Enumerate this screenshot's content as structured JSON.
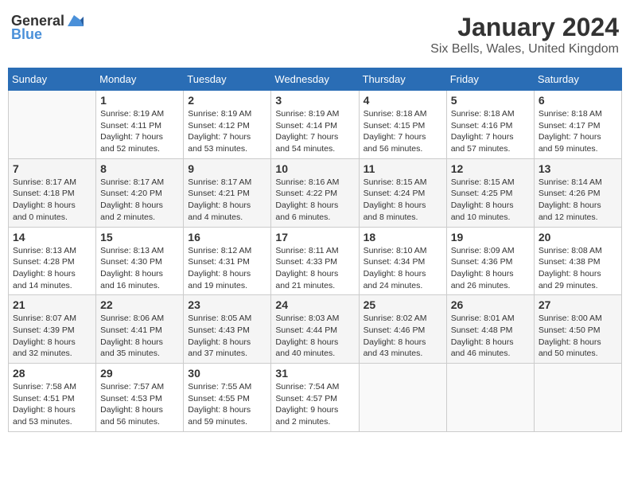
{
  "header": {
    "logo_general": "General",
    "logo_blue": "Blue",
    "month_title": "January 2024",
    "location": "Six Bells, Wales, United Kingdom"
  },
  "weekdays": [
    "Sunday",
    "Monday",
    "Tuesday",
    "Wednesday",
    "Thursday",
    "Friday",
    "Saturday"
  ],
  "weeks": [
    [
      {
        "day": "",
        "info": ""
      },
      {
        "day": "1",
        "info": "Sunrise: 8:19 AM\nSunset: 4:11 PM\nDaylight: 7 hours\nand 52 minutes."
      },
      {
        "day": "2",
        "info": "Sunrise: 8:19 AM\nSunset: 4:12 PM\nDaylight: 7 hours\nand 53 minutes."
      },
      {
        "day": "3",
        "info": "Sunrise: 8:19 AM\nSunset: 4:14 PM\nDaylight: 7 hours\nand 54 minutes."
      },
      {
        "day": "4",
        "info": "Sunrise: 8:18 AM\nSunset: 4:15 PM\nDaylight: 7 hours\nand 56 minutes."
      },
      {
        "day": "5",
        "info": "Sunrise: 8:18 AM\nSunset: 4:16 PM\nDaylight: 7 hours\nand 57 minutes."
      },
      {
        "day": "6",
        "info": "Sunrise: 8:18 AM\nSunset: 4:17 PM\nDaylight: 7 hours\nand 59 minutes."
      }
    ],
    [
      {
        "day": "7",
        "info": "Sunrise: 8:17 AM\nSunset: 4:18 PM\nDaylight: 8 hours\nand 0 minutes."
      },
      {
        "day": "8",
        "info": "Sunrise: 8:17 AM\nSunset: 4:20 PM\nDaylight: 8 hours\nand 2 minutes."
      },
      {
        "day": "9",
        "info": "Sunrise: 8:17 AM\nSunset: 4:21 PM\nDaylight: 8 hours\nand 4 minutes."
      },
      {
        "day": "10",
        "info": "Sunrise: 8:16 AM\nSunset: 4:22 PM\nDaylight: 8 hours\nand 6 minutes."
      },
      {
        "day": "11",
        "info": "Sunrise: 8:15 AM\nSunset: 4:24 PM\nDaylight: 8 hours\nand 8 minutes."
      },
      {
        "day": "12",
        "info": "Sunrise: 8:15 AM\nSunset: 4:25 PM\nDaylight: 8 hours\nand 10 minutes."
      },
      {
        "day": "13",
        "info": "Sunrise: 8:14 AM\nSunset: 4:26 PM\nDaylight: 8 hours\nand 12 minutes."
      }
    ],
    [
      {
        "day": "14",
        "info": "Sunrise: 8:13 AM\nSunset: 4:28 PM\nDaylight: 8 hours\nand 14 minutes."
      },
      {
        "day": "15",
        "info": "Sunrise: 8:13 AM\nSunset: 4:30 PM\nDaylight: 8 hours\nand 16 minutes."
      },
      {
        "day": "16",
        "info": "Sunrise: 8:12 AM\nSunset: 4:31 PM\nDaylight: 8 hours\nand 19 minutes."
      },
      {
        "day": "17",
        "info": "Sunrise: 8:11 AM\nSunset: 4:33 PM\nDaylight: 8 hours\nand 21 minutes."
      },
      {
        "day": "18",
        "info": "Sunrise: 8:10 AM\nSunset: 4:34 PM\nDaylight: 8 hours\nand 24 minutes."
      },
      {
        "day": "19",
        "info": "Sunrise: 8:09 AM\nSunset: 4:36 PM\nDaylight: 8 hours\nand 26 minutes."
      },
      {
        "day": "20",
        "info": "Sunrise: 8:08 AM\nSunset: 4:38 PM\nDaylight: 8 hours\nand 29 minutes."
      }
    ],
    [
      {
        "day": "21",
        "info": "Sunrise: 8:07 AM\nSunset: 4:39 PM\nDaylight: 8 hours\nand 32 minutes."
      },
      {
        "day": "22",
        "info": "Sunrise: 8:06 AM\nSunset: 4:41 PM\nDaylight: 8 hours\nand 35 minutes."
      },
      {
        "day": "23",
        "info": "Sunrise: 8:05 AM\nSunset: 4:43 PM\nDaylight: 8 hours\nand 37 minutes."
      },
      {
        "day": "24",
        "info": "Sunrise: 8:03 AM\nSunset: 4:44 PM\nDaylight: 8 hours\nand 40 minutes."
      },
      {
        "day": "25",
        "info": "Sunrise: 8:02 AM\nSunset: 4:46 PM\nDaylight: 8 hours\nand 43 minutes."
      },
      {
        "day": "26",
        "info": "Sunrise: 8:01 AM\nSunset: 4:48 PM\nDaylight: 8 hours\nand 46 minutes."
      },
      {
        "day": "27",
        "info": "Sunrise: 8:00 AM\nSunset: 4:50 PM\nDaylight: 8 hours\nand 50 minutes."
      }
    ],
    [
      {
        "day": "28",
        "info": "Sunrise: 7:58 AM\nSunset: 4:51 PM\nDaylight: 8 hours\nand 53 minutes."
      },
      {
        "day": "29",
        "info": "Sunrise: 7:57 AM\nSunset: 4:53 PM\nDaylight: 8 hours\nand 56 minutes."
      },
      {
        "day": "30",
        "info": "Sunrise: 7:55 AM\nSunset: 4:55 PM\nDaylight: 8 hours\nand 59 minutes."
      },
      {
        "day": "31",
        "info": "Sunrise: 7:54 AM\nSunset: 4:57 PM\nDaylight: 9 hours\nand 2 minutes."
      },
      {
        "day": "",
        "info": ""
      },
      {
        "day": "",
        "info": ""
      },
      {
        "day": "",
        "info": ""
      }
    ]
  ]
}
